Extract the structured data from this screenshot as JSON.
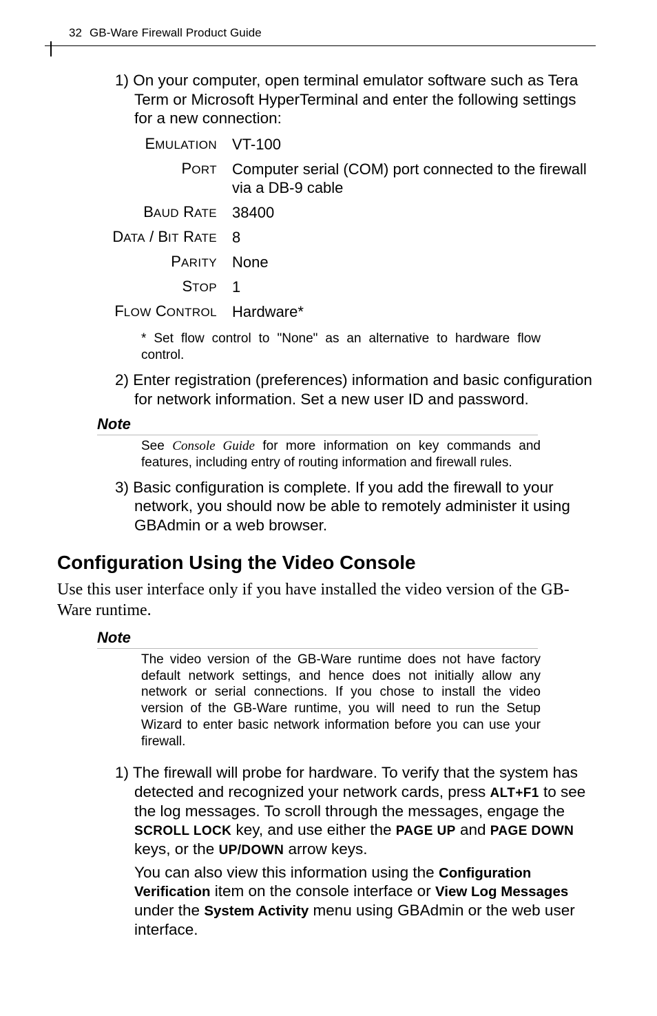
{
  "header": {
    "page_number": "32",
    "title": "GB-Ware Firewall Product Guide"
  },
  "steps": {
    "s1": "1) On your computer, open terminal emulator software such as Tera Term or Microsoft HyperTerminal and enter the following settings for a new connection:",
    "s2": "2) Enter registration (preferences) information and basic configuration for network information. Set a new user ID and password.",
    "s3": "3) Basic configuration is complete. If you add the firewall to your network, you should now be able to remotely administer it using GBAdmin or a web browser."
  },
  "settings": {
    "emulation": {
      "label_lead": "E",
      "label_rest": "MULATION",
      "value": "VT-100"
    },
    "port": {
      "label_lead": "P",
      "label_rest": "ORT",
      "value": "Computer serial (COM) port connected to the firewall via a DB-9 cable"
    },
    "baud": {
      "label_lead": "B",
      "label_rest": "AUD",
      "label2_lead": "R",
      "label2_rest": "ATE",
      "value": "38400"
    },
    "databit": {
      "label_lead": "D",
      "label_rest": "ATA",
      "sep": " / ",
      "label2_lead": "B",
      "label2_rest": "IT",
      "label3_lead": "R",
      "label3_rest": "ATE",
      "value": "8"
    },
    "parity": {
      "label_lead": "P",
      "label_rest": "ARITY",
      "value": "None"
    },
    "stop": {
      "label_lead": "S",
      "label_rest": "TOP",
      "value": "1"
    },
    "flow": {
      "label_lead": "F",
      "label_rest": "LOW",
      "label2_lead": "C",
      "label2_rest": "ONTROL",
      "value": "Hardware*"
    }
  },
  "footnote": "* Set flow control to \"None\" as an alternative to hardware flow control.",
  "note1": {
    "heading": "Note",
    "body_prefix": "See ",
    "body_em": "Console Guide",
    "body_suffix": " for more information on key commands and features, including entry of routing information and firewall rules."
  },
  "section_title": "Configuration Using the Video Console",
  "intro": "Use this user interface only if you have installed the video version of the GB-Ware runtime.",
  "note2": {
    "heading": "Note",
    "body": "The video version of the GB-Ware runtime does not have factory default network settings, and hence does not initially allow any network or serial connections. If you chose to install the video version of the GB-Ware runtime, you will need to run the Setup Wizard to enter basic network information before you can use your firewall."
  },
  "video_step1": {
    "p1a": "1) The firewall will probe for hardware. To verify that the system has detected and recognized your network cards, press ",
    "key_altf1": "ALT+F1",
    "p1b": " to see the log messages. To scroll through the messages, engage the ",
    "key_scroll": "SCROLL LOCK",
    "p1c": " key, and use either the ",
    "key_pgup": "PAGE UP",
    "p1d": " and ",
    "key_pgdn": "PAGE DOWN",
    "p1e": " keys, or the ",
    "key_updown": "UP/DOWN",
    "p1f": " arrow keys.",
    "p2a": "You can also view this information using the ",
    "ui_confver": "Configuration Verification",
    "p2b": " item on the console interface or ",
    "ui_viewlog": "View Log Messages",
    "p2c": " under the ",
    "ui_sysact": "System Activity",
    "p2d": " menu using GBAdmin or the web user interface."
  }
}
